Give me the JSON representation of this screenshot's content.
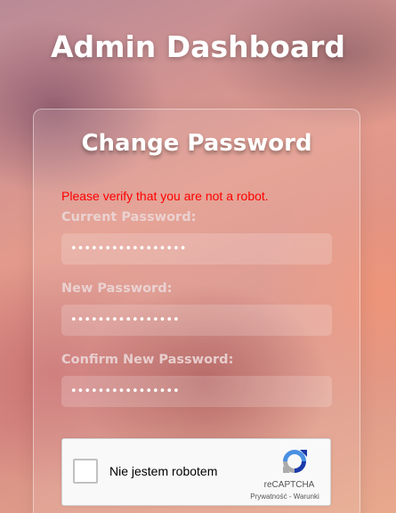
{
  "header": {
    "title": "Admin Dashboard"
  },
  "form": {
    "title": "Change Password",
    "error": "Please verify that you are not a robot.",
    "fields": [
      {
        "label": "Current Password:",
        "value": "•••••••••••••••••"
      },
      {
        "label": "New Password:",
        "value": "••••••••••••••••"
      },
      {
        "label": "Confirm New Password:",
        "value": "••••••••••••••••"
      }
    ]
  },
  "recaptcha": {
    "label": "Nie jestem robotem",
    "brand": "reCAPTCHA",
    "privacy": "Prywatność",
    "separator": " - ",
    "terms": "Warunki",
    "icon": "recaptcha-logo-icon"
  },
  "colors": {
    "error": "#ff0000",
    "heading": "#ffffff",
    "recaptcha_blue": "#1c3aa9",
    "recaptcha_light_blue": "#4a90e2",
    "recaptcha_gray": "#ababab"
  }
}
